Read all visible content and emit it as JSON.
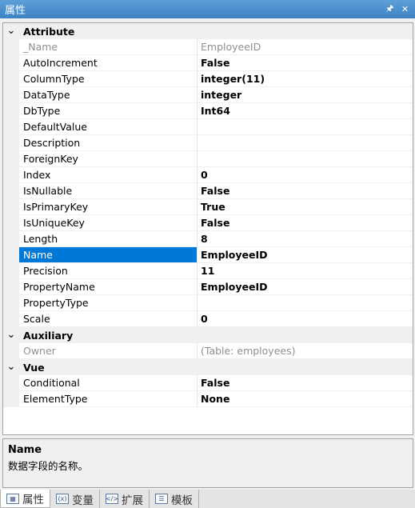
{
  "window": {
    "title": "属性",
    "pin_glyph": "🖈",
    "close_glyph": "✕"
  },
  "categories": [
    {
      "label": "Attribute",
      "properties": [
        {
          "name": "_Name",
          "value": "EmployeeID",
          "readonly": true
        },
        {
          "name": "AutoIncrement",
          "value": "False",
          "bold": true
        },
        {
          "name": "ColumnType",
          "value": "integer(11)",
          "bold": true
        },
        {
          "name": "DataType",
          "value": "integer",
          "bold": true
        },
        {
          "name": "DbType",
          "value": "Int64",
          "bold": true
        },
        {
          "name": "DefaultValue",
          "value": ""
        },
        {
          "name": "Description",
          "value": ""
        },
        {
          "name": "ForeignKey",
          "value": ""
        },
        {
          "name": "Index",
          "value": "0",
          "bold": true
        },
        {
          "name": "IsNullable",
          "value": "False",
          "bold": true
        },
        {
          "name": "IsPrimaryKey",
          "value": "True",
          "bold": true
        },
        {
          "name": "IsUniqueKey",
          "value": "False",
          "bold": true
        },
        {
          "name": "Length",
          "value": "8",
          "bold": true
        },
        {
          "name": "Name",
          "value": "EmployeeID",
          "bold": true,
          "selected": true
        },
        {
          "name": "Precision",
          "value": "11",
          "bold": true
        },
        {
          "name": "PropertyName",
          "value": "EmployeeID",
          "bold": true
        },
        {
          "name": "PropertyType",
          "value": ""
        },
        {
          "name": "Scale",
          "value": "0",
          "bold": true
        }
      ]
    },
    {
      "label": "Auxiliary",
      "properties": [
        {
          "name": "Owner",
          "value": "(Table: employees)",
          "readonly": true
        }
      ]
    },
    {
      "label": "Vue",
      "properties": [
        {
          "name": "Conditional",
          "value": "False",
          "bold": true
        },
        {
          "name": "ElementType",
          "value": "None",
          "bold": true
        }
      ]
    }
  ],
  "description": {
    "title": "Name",
    "text": "数据字段的名称。"
  },
  "tabs": [
    {
      "label": "属性",
      "icon": "properties-icon",
      "glyph": "▦",
      "active": true
    },
    {
      "label": "变量",
      "icon": "variables-icon",
      "glyph": "(x)"
    },
    {
      "label": "扩展",
      "icon": "extensions-icon",
      "glyph": "</>"
    },
    {
      "label": "模板",
      "icon": "templates-icon",
      "glyph": "☰"
    }
  ],
  "colors": {
    "titlebar": "#3c82c4",
    "selection": "#0078d7",
    "readonly_text": "#909090"
  }
}
